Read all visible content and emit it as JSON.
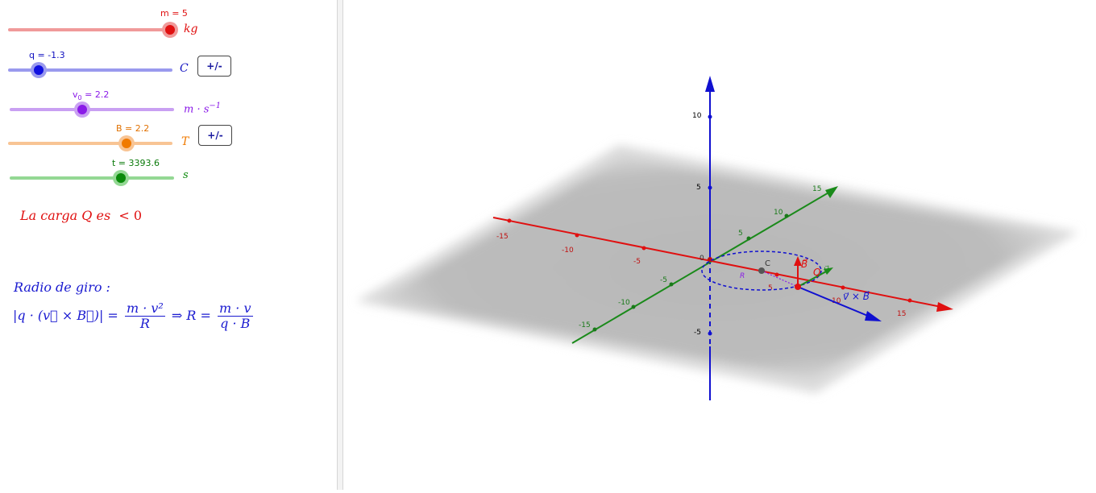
{
  "sliders": [
    {
      "id": "m",
      "label": "m = 5",
      "unit": "kg",
      "fraction": 1.0,
      "color": "#e01010",
      "track": "#f09a9a"
    },
    {
      "id": "q",
      "label": "q = -1.3",
      "unit": "C",
      "fraction": 0.185,
      "color": "#1010e0",
      "track": "#9a9aee"
    },
    {
      "id": "v",
      "label_var": "v",
      "label_sub": "0",
      "label_rest": " = 2.2",
      "unit_base": "m · s",
      "unit_exp": "−1",
      "fraction": 0.44,
      "color": "#8a1ae8",
      "track": "#c9a0f2"
    },
    {
      "id": "B",
      "label": "B = 2.2",
      "unit": "T",
      "fraction": 0.72,
      "color": "#f07a00",
      "track": "#f8c494"
    },
    {
      "id": "t",
      "label": "t = 3393.6",
      "unit": "s",
      "fraction": 0.675,
      "color": "#0a8a0a",
      "track": "#94d894"
    }
  ],
  "buttons": {
    "q_sign": "+/-",
    "b_sign": "+/-"
  },
  "carga_text": {
    "prefix": "La carga Q es",
    "rel": "< 0",
    "color": "#e01010"
  },
  "radio": {
    "title": "Radio de giro :",
    "lhs": "|q · (v⃗ × B⃗)| =",
    "f1_num": "m · v²",
    "f1_den": "R",
    "arrow": "⇒ R =",
    "f2_num": "m · v",
    "f2_den": "q · B"
  },
  "view3d": {
    "z_ticks": [
      "10",
      "5",
      "-5"
    ],
    "x_ticks_neg": [
      "-15",
      "-10",
      "-5"
    ],
    "x_ticks_pos": [
      "5",
      "10",
      "15"
    ],
    "y_ticks_pos": [
      "5",
      "10",
      "15"
    ],
    "y_ticks_neg": [
      "-5",
      "-10",
      "-15"
    ],
    "origin": "0",
    "point_c": "C",
    "vec_b": "B⃗",
    "vec_q": "Q",
    "vec_v": "v⃗",
    "vec_vxb": "v⃗ × B⃗",
    "radius_label": "R",
    "colors": {
      "x": "#e01010",
      "y": "#1a8a1a",
      "z": "#1010d0",
      "plane": "#b8b8b8"
    }
  }
}
